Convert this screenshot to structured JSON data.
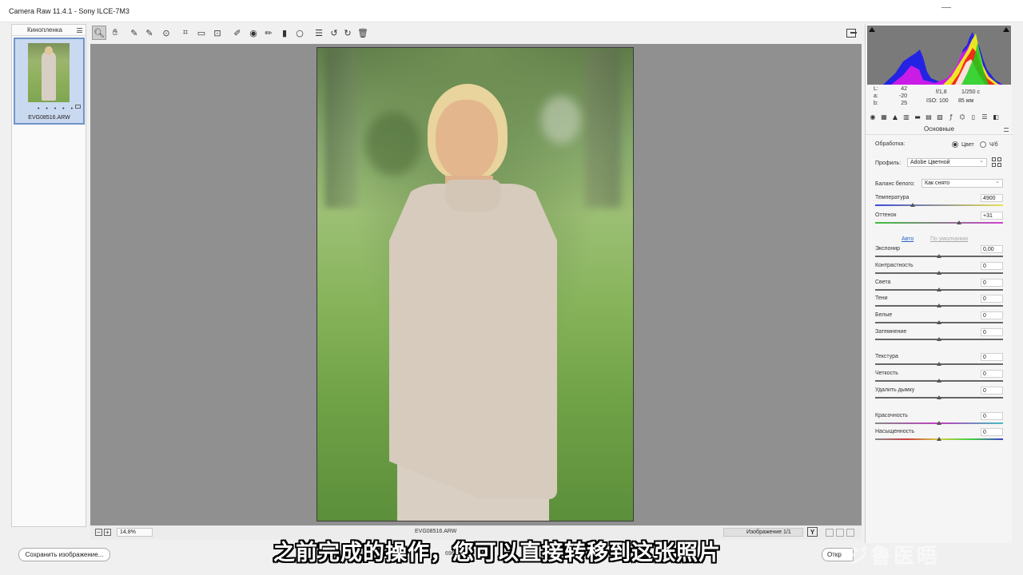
{
  "window": {
    "title": "Camera Raw 11.4.1  -  Sony ILCE-7M3"
  },
  "filmstrip": {
    "header": "Кинопленка",
    "item": {
      "filename": "EVG08516.ARW",
      "stars": "• • • • •"
    }
  },
  "toolbar": {
    "tools": [
      "zoom-tool",
      "hand-tool",
      "white-balance-tool",
      "color-sampler-tool",
      "targeted-adjustment-tool",
      "crop-tool",
      "straighten-tool",
      "transform-tool",
      "spot-removal-tool",
      "red-eye-tool",
      "adjustment-brush",
      "graduated-filter",
      "radial-filter",
      "preferences",
      "rotate-ccw",
      "rotate-cw",
      "trash"
    ]
  },
  "canvas": {
    "filename": "EVG08516.ARW",
    "zoom": "14,8%",
    "nav_label": "Изображение 1/1",
    "view_toggle": "Y"
  },
  "info": {
    "L_label": "L:",
    "L": "42",
    "a_label": "a:",
    "a": "-20",
    "b_label": "b:",
    "b": "25",
    "aperture": "f/1,8",
    "shutter": "1/250 с",
    "iso": "ISO: 100",
    "focal": "85 мм"
  },
  "panel": {
    "title": "Основные",
    "treatment_label": "Обработка:",
    "color_option": "Цвет",
    "bw_option": "Ч/б",
    "profile_label": "Профиль:",
    "profile_value": "Adobe Цветной",
    "wb_label": "Баланс белого:",
    "wb_value": "Как снято",
    "temp_label": "Температура",
    "temp_value": "4900",
    "tint_label": "Оттенок",
    "tint_value": "+31",
    "auto_link": "Авто",
    "default_link": "По умолчанию",
    "sliders": [
      {
        "label": "Экспонир",
        "value": "0,00"
      },
      {
        "label": "Контрастность",
        "value": "0"
      },
      {
        "label": "Света",
        "value": "0"
      },
      {
        "label": "Тени",
        "value": "0"
      },
      {
        "label": "Белые",
        "value": "0"
      },
      {
        "label": "Затемнение",
        "value": "0"
      },
      {
        "label": "Текстура",
        "value": "0"
      },
      {
        "label": "Четкость",
        "value": "0"
      },
      {
        "label": "Удалить дымку",
        "value": "0"
      },
      {
        "label": "Красочность",
        "value": "0"
      },
      {
        "label": "Насыщенность",
        "value": "0"
      }
    ]
  },
  "buttons": {
    "save": "Сохранить изображение...",
    "open": "Откр"
  },
  "overlay": {
    "subtitle": "之前完成的操作，您可以直接转移到这张照片",
    "under_text": "6966-2",
    "watermark": "ジ鲁医晤"
  }
}
